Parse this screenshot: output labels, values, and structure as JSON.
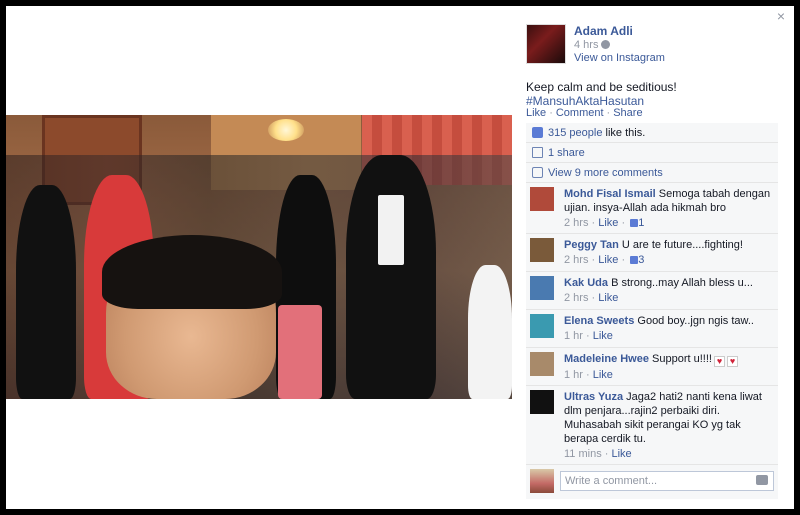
{
  "post": {
    "author": "Adam Adli",
    "time": "4 hrs",
    "via": "View on Instagram",
    "status_text": "Keep calm and be seditious!",
    "hashtag": "#MansuhAktaHasutan"
  },
  "actions": {
    "like": "Like",
    "comment": "Comment",
    "share": "Share"
  },
  "ufi": {
    "likes_link": "315 people",
    "likes_suffix": "like this.",
    "shares": "1 share",
    "more_comments": "View 9 more comments"
  },
  "comments": [
    {
      "name": "Mohd Fisal Ismail",
      "text": "Semoga tabah dengan ujian. insya-Allah ada hikmah bro",
      "time": "2 hrs",
      "like": "Like",
      "likes": "1",
      "avatar_color": "#b04a3a"
    },
    {
      "name": "Peggy Tan",
      "text": "U are te future....fighting!",
      "time": "2 hrs",
      "like": "Like",
      "likes": "3",
      "avatar_color": "#7a5a3a"
    },
    {
      "name": "Kak Uda",
      "text": "B strong..may Allah bless u...",
      "time": "2 hrs",
      "like": "Like",
      "likes": "",
      "avatar_color": "#4a7ab0"
    },
    {
      "name": "Elena Sweets",
      "text": "Good boy..jgn ngis taw..",
      "time": "1 hr",
      "like": "Like",
      "likes": "",
      "avatar_color": "#3a9ab0"
    },
    {
      "name": "Madeleine Hwee",
      "text": "Support u!!!!",
      "time": "1 hr",
      "like": "Like",
      "likes": "",
      "avatar_color": "#a88a6a"
    },
    {
      "name": "Ultras Yuza",
      "text": "Jaga2 hati2 nanti kena liwat dlm penjara...rajin2 perbaiki diri. Muhasabah sikit perangai KO yg tak berapa cerdik tu.",
      "time": "11 mins",
      "like": "Like",
      "likes": "",
      "avatar_color": "#111111"
    }
  ],
  "reply": {
    "placeholder": "Write a comment..."
  },
  "icons": {
    "close": "×",
    "heart": "♥"
  }
}
